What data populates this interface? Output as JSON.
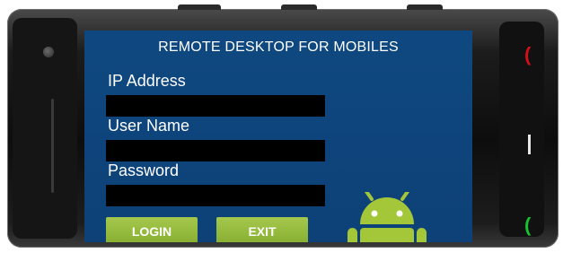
{
  "app": {
    "title": "REMOTE DESKTOP FOR MOBILES"
  },
  "form": {
    "ip_label": "IP Address",
    "ip_value": "",
    "username_label": "User Name",
    "username_value": "",
    "password_label": "Password",
    "password_value": ""
  },
  "buttons": {
    "login": "LOGIN",
    "exit": "EXIT"
  },
  "icons": {
    "logo": "android-robot-icon",
    "end_call": "end-call-icon",
    "menu": "menu-key-icon",
    "call": "call-icon",
    "camera": "camera-icon",
    "speaker": "speaker-icon"
  },
  "colors": {
    "screen_bg": "#0f4880",
    "button_green": "#95bb3c",
    "android_green": "#a4c639",
    "end_red": "#d3101a",
    "call_green": "#16c22d",
    "input_bg": "#000000"
  }
}
